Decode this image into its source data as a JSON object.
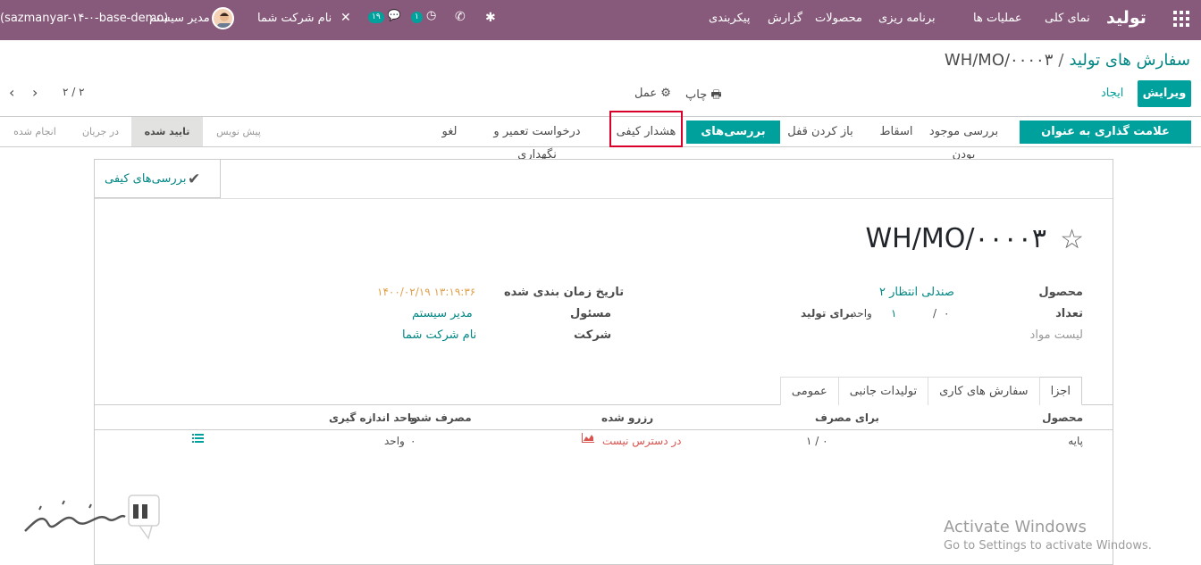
{
  "navbar": {
    "app_title": "تولید",
    "menu": [
      "نمای کلی",
      "عملیات ها",
      "برنامه ریزی",
      "محصولات",
      "گزارش",
      "پیکربندی"
    ],
    "activity_count": "۱",
    "discuss_count": "۱۹",
    "company": "نام شرکت شما",
    "user": "مدیر سیستم",
    "db": "(sazmanyar-۱۴-۰-base-demo)"
  },
  "breadcrumb": {
    "parent": "سفارش های تولید",
    "separator": "/",
    "current": "WH/MO/۰۰۰۰۳"
  },
  "control": {
    "edit": "ویرایش",
    "create": "ایجاد",
    "print": "چاپ",
    "action": "عمل",
    "pager": "۲ / ۲"
  },
  "statusbar": {
    "buttons": [
      "علامت گذاری به عنوان انجام شده",
      "بررسی موجود بودن",
      "اسقاط",
      "باز کردن قفل",
      "بررسی‌های کیفی",
      "هشدار کیفی",
      "درخواست تعمیر و نگهداری",
      "لغو"
    ],
    "stages": [
      "پیش نویس",
      "تایید شده",
      "در جریان",
      "انجام شده"
    ]
  },
  "sheet": {
    "smart_button": "بررسی‌های کیفی",
    "title": "WH/MO/۰۰۰۰۳",
    "product_label": "محصول",
    "product_value": "صندلی انتظار ۲",
    "qty_label": "تعداد",
    "qty_produced": "۰",
    "qty_sep": "/",
    "qty_total": "۱",
    "qty_uom": "واحد",
    "qty_to_produce": "برای تولید",
    "bom_label": "لیست مواد",
    "date_label": "تاریخ زمان بندی شده",
    "date_value": "۱۴۰۰/۰۲/۱۹ ۱۳:۱۹:۳۶",
    "responsible_label": "مسئول",
    "responsible_value": "مدیر سیستم",
    "company_label": "شرکت",
    "company_value": "نام شرکت شما"
  },
  "tabs": [
    "اجزا",
    "سفارش های کاری",
    "تولیدات جانبی",
    "عمومی"
  ],
  "components_table": {
    "headers": [
      "محصول",
      "برای مصرف",
      "رزرو شده",
      "مصرف شده",
      "واحد اندازه گیری"
    ],
    "rows": [
      {
        "product": "پایه",
        "to_consume": "۱ / ۰",
        "reserved": "در دسترس نیست",
        "consumed": "۰",
        "uom": "واحد"
      }
    ]
  },
  "overlay": {
    "activate_title": "Activate Windows",
    "activate_sub": "Go to Settings to activate Windows."
  },
  "colors": {
    "navbar": "#875a7b",
    "primary": "#00a09d",
    "link": "#008784",
    "highlight": "#d9002a",
    "unavailable": "#d9534f"
  }
}
